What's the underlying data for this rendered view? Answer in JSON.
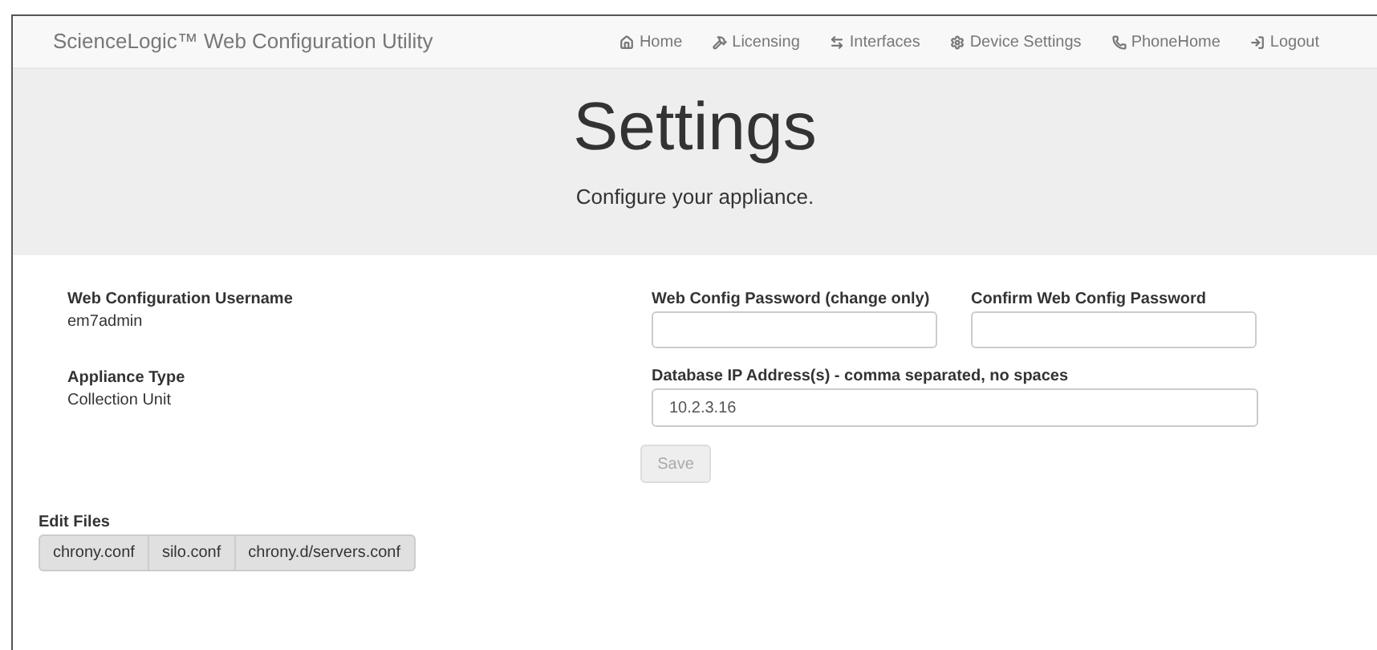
{
  "navbar": {
    "brand": "ScienceLogic™ Web Configuration Utility",
    "links": [
      {
        "label": "Home"
      },
      {
        "label": "Licensing"
      },
      {
        "label": "Interfaces"
      },
      {
        "label": "Device Settings"
      },
      {
        "label": "PhoneHome"
      },
      {
        "label": "Logout"
      }
    ]
  },
  "header": {
    "title": "Settings",
    "subtitle": "Configure your appliance."
  },
  "info": [
    {
      "label": "Web Configuration Username",
      "value": "em7admin"
    },
    {
      "label": "Appliance Type",
      "value": "Collection Unit"
    }
  ],
  "password_fields": [
    {
      "label": "Web Config Password (change only)"
    },
    {
      "label": "Confirm Web Config Password"
    }
  ],
  "ip_field": {
    "label": "Database IP Address(s) - comma separated, no spaces",
    "value": "10.2.3.16"
  },
  "save_button": {
    "label": "Save",
    "disabled": true
  },
  "edit_files": {
    "title": "Edit Files",
    "files": [
      "chrony.conf",
      "silo.conf",
      "chrony.d/servers.conf"
    ]
  }
}
